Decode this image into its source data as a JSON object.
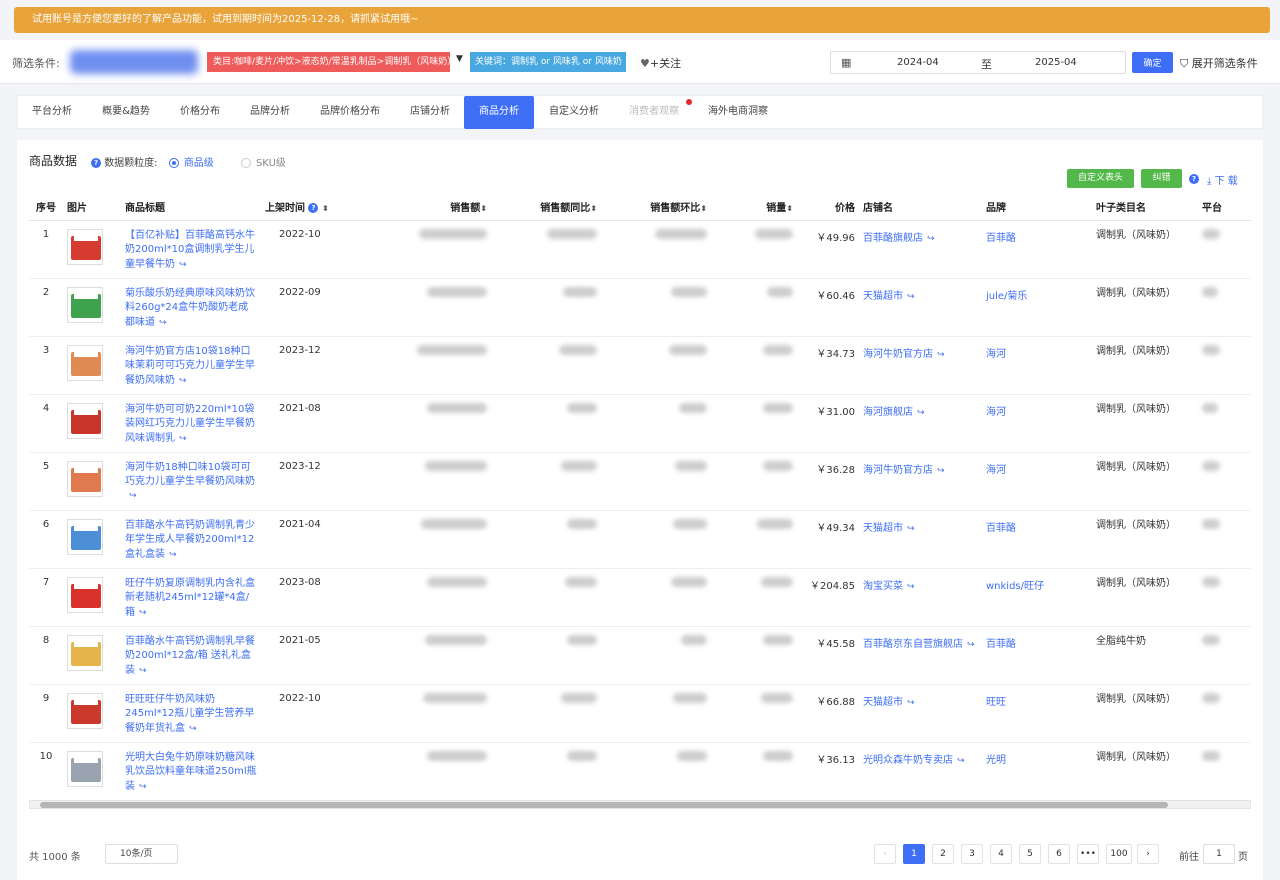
{
  "banner": {
    "text": "试用账号是方便您更好的了解产品功能，试用到期时间为2025-12-28，请抓紧试用哦~"
  },
  "filters": {
    "label": "筛选条件:",
    "category_tag": "类目:咖啡/麦片/冲饮>液态奶/常温乳制品>调制乳（风味奶）",
    "keyword_tag": "关键词：调制乳 or 风味乳 or 风味奶",
    "follow": "+关注",
    "date_start": "2024-04",
    "date_to": "至",
    "date_end": "2025-04",
    "confirm": "确定",
    "expand": "展开筛选条件"
  },
  "tabs": [
    "平台分析",
    "概要&趋势",
    "价格分布",
    "品牌分析",
    "品牌价格分布",
    "店铺分析",
    "商品分析",
    "自定义分析",
    "消费者观察",
    "海外电商洞察"
  ],
  "active_tab": "商品分析",
  "panel": {
    "title": "商品数据",
    "granularity_label": "数据颗粒度:",
    "gran_product": "商品级",
    "gran_sku": "SKU级",
    "custom_header_btn": "自定义表头",
    "correct_btn": "纠错",
    "download": "下 载"
  },
  "columns": {
    "idx": "序号",
    "img": "图片",
    "title": "商品标题",
    "listed": "上架时间",
    "sales_amount": "销售额",
    "yoy": "销售额同比",
    "mom": "销售额环比",
    "volume": "销量",
    "price": "价格",
    "shop": "店铺名",
    "brand": "品牌",
    "leaf_cat": "叶子类目名",
    "platform": "平台"
  },
  "rows": [
    {
      "idx": "1",
      "title": "【百亿补贴】百菲酪高钙水牛奶200ml*10盒调制乳学生儿童早餐牛奶",
      "date": "2022-10",
      "price": "￥49.96",
      "shop": "百菲酪旗舰店",
      "brand": "百菲酪",
      "cat": "调制乳（风味奶）",
      "thumb": "#d63b2f"
    },
    {
      "idx": "2",
      "title": "菊乐酸乐奶经典原味风味奶饮料260g*24盒牛奶酸奶老成都味道",
      "date": "2022-09",
      "price": "￥60.46",
      "shop": "天猫超市",
      "brand": "jule/菊乐",
      "cat": "调制乳（风味奶）",
      "thumb": "#3fa34d"
    },
    {
      "idx": "3",
      "title": "海河牛奶官方店10袋18种口味茉莉可可巧克力儿童学生早餐奶风味奶",
      "date": "2023-12",
      "price": "￥34.73",
      "shop": "海河牛奶官方店",
      "brand": "海河",
      "cat": "调制乳（风味奶）",
      "thumb": "#e28a54"
    },
    {
      "idx": "4",
      "title": "海河牛奶可可奶220ml*10袋装网红巧克力儿童学生早餐奶风味调制乳",
      "date": "2021-08",
      "price": "￥31.00",
      "shop": "海河旗舰店",
      "brand": "海河",
      "cat": "调制乳（风味奶）",
      "thumb": "#c9352b"
    },
    {
      "idx": "5",
      "title": "海河牛奶18种口味10袋可可巧克力儿童学生早餐奶风味奶",
      "date": "2023-12",
      "price": "￥36.28",
      "shop": "海河牛奶官方店",
      "brand": "海河",
      "cat": "调制乳（风味奶）",
      "thumb": "#e07a4e"
    },
    {
      "idx": "6",
      "title": "百菲酪水牛高钙奶调制乳青少年学生成人早餐奶200ml*12盒礼盒装",
      "date": "2021-04",
      "price": "￥49.34",
      "shop": "天猫超市",
      "brand": "百菲酪",
      "cat": "调制乳（风味奶）",
      "thumb": "#4d8fd6"
    },
    {
      "idx": "7",
      "title": "旺仔牛奶复原调制乳内含礼盒新老随机245ml*12罐*4盒/箱",
      "date": "2023-08",
      "price": "￥204.85",
      "shop": "淘宝买菜",
      "brand": "wnkids/旺仔",
      "cat": "调制乳（风味奶）",
      "thumb": "#d8322a"
    },
    {
      "idx": "8",
      "title": "百菲酪水牛高钙奶调制乳早餐奶200ml*12盒/箱 送礼礼盒装",
      "date": "2021-05",
      "price": "￥45.58",
      "shop": "百菲酪京东自营旗舰店",
      "brand": "百菲酪",
      "cat": "全脂纯牛奶",
      "thumb": "#e6b54a"
    },
    {
      "idx": "9",
      "title": "旺旺旺仔牛奶风味奶245ml*12瓶儿童学生营养早餐奶年货礼盒",
      "date": "2022-10",
      "price": "￥66.88",
      "shop": "天猫超市",
      "brand": "旺旺",
      "cat": "调制乳（风味奶）",
      "thumb": "#c93a2d"
    },
    {
      "idx": "10",
      "title": "光明大白兔牛奶原味奶糖风味乳饮品饮料童年味道250ml瓶装",
      "date": "",
      "price": "￥36.13",
      "shop": "光明众森牛奶专卖店",
      "brand": "光明",
      "cat": "调制乳（风味奶）",
      "thumb": "#9aa4b0"
    }
  ],
  "pagination": {
    "total": "共 1000 条",
    "page_size": "10条/页",
    "pages": [
      "1",
      "2",
      "3",
      "4",
      "5",
      "6",
      "•••",
      "100"
    ],
    "current": "1",
    "goto_prefix": "前往",
    "goto_value": "1",
    "goto_suffix": "页"
  }
}
